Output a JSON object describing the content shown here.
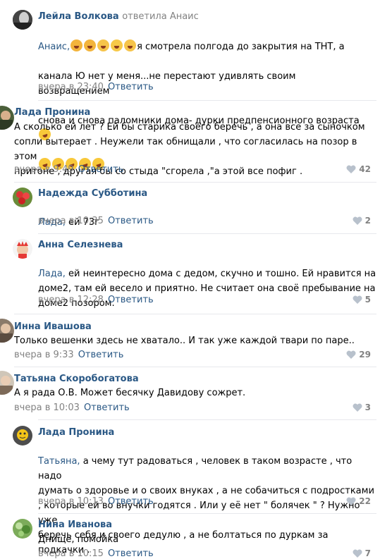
{
  "comments": [
    {
      "author": "Лейла Волкова",
      "addressee_prefix": "ответила",
      "addressee": "Анаис",
      "mention": "Анаис,",
      "lines": [
        "я смотрела полгода до закрытия на ТНТ, а",
        "канала Ю нет у меня...не перестают удивлять своим возвращением",
        "снова и снова паломники дома- дурки предпенсионного возраста"
      ],
      "time": "вчера в 23:40",
      "reply_label": "Ответить",
      "likes": ""
    },
    {
      "author": "Лада Пронина",
      "text": "А сколько ей лет ? Ей бы старика своего беречь , а она все за сыночком\nсопли вытерает . Неужели так обнищали , что согласилась на позор в этом\nпритоне , другая бы со стыда \"сгорела ,\"а этой все пофиг .",
      "time": "вчера в 9:49",
      "reply_label": "Ответить",
      "likes": "42"
    },
    {
      "author": "Надежда Субботина",
      "mention": "Лада,",
      "text": "ей 73г",
      "time": "вчера в 10:35",
      "reply_label": "Ответить",
      "likes": "2"
    },
    {
      "author": "Анна Селезнева",
      "mention": "Лада,",
      "text": "ей неинтересно дома с дедом, скучно и тошно. Ей нравится на\nдоме2, там ей весело и приятно. Не считает она своё пребывание на\nдоме2 позором.",
      "time": "вчера в 12:28",
      "reply_label": "Ответить",
      "likes": "5"
    },
    {
      "author": "Инна Ивашова",
      "text": "Только вешенки здесь не хватало.. И так уже каждой твари по паре..",
      "time": "вчера в 9:33",
      "reply_label": "Ответить",
      "likes": "29"
    },
    {
      "author": "Татьяна Скоробогатова",
      "text": "А я рада О.В. Может бесячку Давидову сожрет.",
      "time": "вчера в 10:03",
      "reply_label": "Ответить",
      "likes": "3"
    },
    {
      "author": "Лада Пронина",
      "mention": "Татьяна,",
      "text": "а чему тут радоваться , человек в таком возрасте , что надо\nдумать о здоровье и о своих внуках , а не собачиться с подростками\n, которые ей во внучки годятся . Или у её нет \" болячек \" ? Нужно уже\nберечь себя и своего дедулю , а не болтаться по дуркам за подкачки .",
      "time": "вчера в 10:13",
      "reply_label": "Ответить",
      "likes": "22"
    },
    {
      "author": "Нина Иванова",
      "text": "Днище, помойка",
      "time": "вчера в 10:15",
      "reply_label": "Ответить",
      "likes": "7"
    }
  ],
  "colors": {
    "link": "#2a5885",
    "meta": "#828282",
    "divider": "#e7e8ec"
  }
}
